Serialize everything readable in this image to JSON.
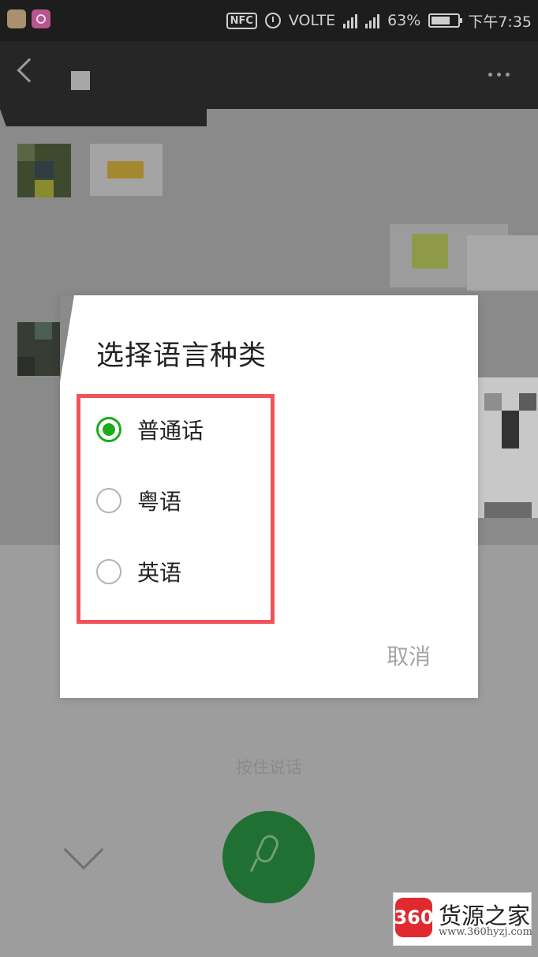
{
  "status_bar": {
    "nfc": "NFC",
    "volte": "VOLTE",
    "battery": "63%",
    "time": "下午7:35",
    "icons": [
      "shield-app-icon",
      "pink-app-icon",
      "alarm-icon",
      "signal-icon",
      "4g-signal-icon",
      "battery-icon"
    ]
  },
  "nav": {
    "icons": [
      "back-arrow-icon",
      "more-dots-icon"
    ]
  },
  "dialog": {
    "title": "选择语言种类",
    "options": [
      {
        "label": "普通话",
        "checked": true
      },
      {
        "label": "粤语",
        "checked": false
      },
      {
        "label": "英语",
        "checked": false
      }
    ],
    "cancel_label": "取消",
    "highlight_color": "#ee5359",
    "accent_color": "#1aad19"
  },
  "voice_panel": {
    "hint": "按住说话",
    "icons": [
      "collapse-chevron-icon",
      "microphone-icon"
    ]
  },
  "watermark": {
    "badge": "360",
    "name": "货源之家",
    "url": "www.360hyzj.com"
  }
}
